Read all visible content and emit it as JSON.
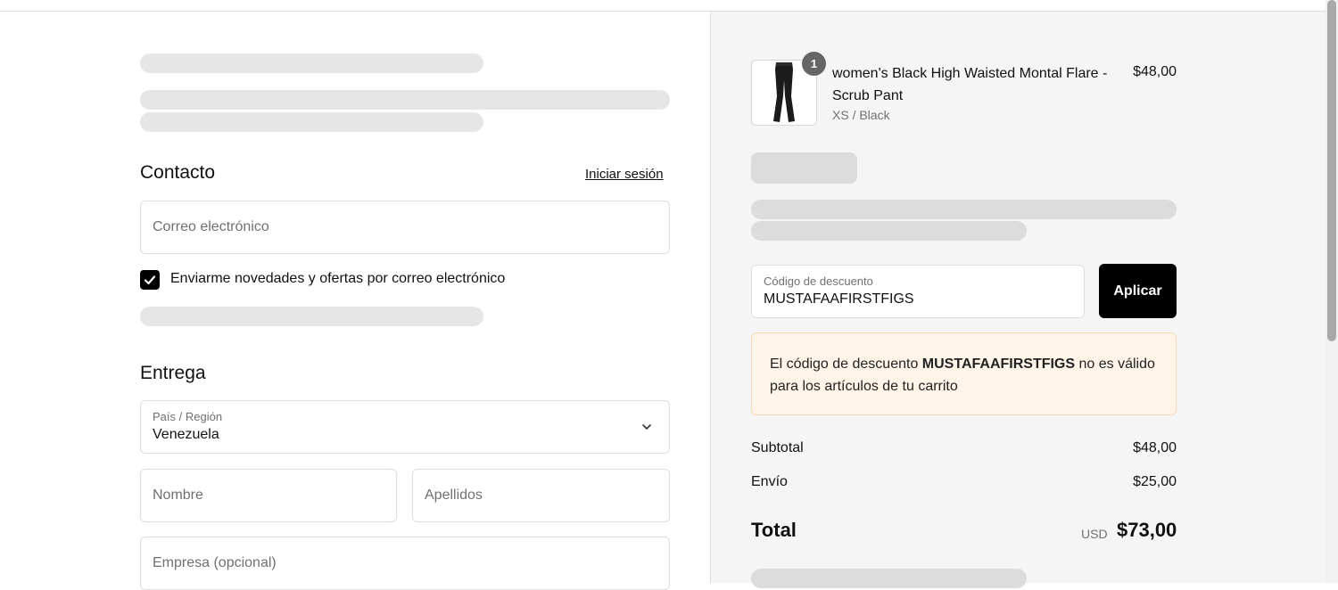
{
  "contact": {
    "heading": "Contacto",
    "login_link": "Iniciar sesión",
    "email_placeholder": "Correo electrónico",
    "newsletter_label": "Enviarme novedades y ofertas por correo electrónico",
    "newsletter_checked": true
  },
  "delivery": {
    "heading": "Entrega",
    "country_label": "País / Región",
    "country_value": "Venezuela",
    "first_name_placeholder": "Nombre",
    "last_name_placeholder": "Apellidos",
    "company_placeholder": "Empresa (opcional)"
  },
  "cart": {
    "item": {
      "quantity": "1",
      "name": "women's Black High Waisted Montal Flare - Scrub Pant",
      "variant": "XS / Black",
      "price": "$48,00"
    }
  },
  "discount": {
    "label": "Código de descuento",
    "value": "MUSTAFAAFIRSTFIGS",
    "apply_label": "Aplicar",
    "error_prefix": "El código de descuento ",
    "error_code": "MUSTAFAAFIRSTFIGS",
    "error_suffix": " no es válido para los artículos de tu carrito"
  },
  "summary": {
    "subtotal_label": "Subtotal",
    "subtotal_value": "$48,00",
    "shipping_label": "Envío",
    "shipping_value": "$25,00",
    "total_label": "Total",
    "currency": "USD",
    "total_value": "$73,00"
  },
  "colors": {
    "accent": "#000000",
    "error_bg": "#fff4e8",
    "error_border": "#f7d8b5",
    "panel_bg": "#f5f5f5"
  }
}
